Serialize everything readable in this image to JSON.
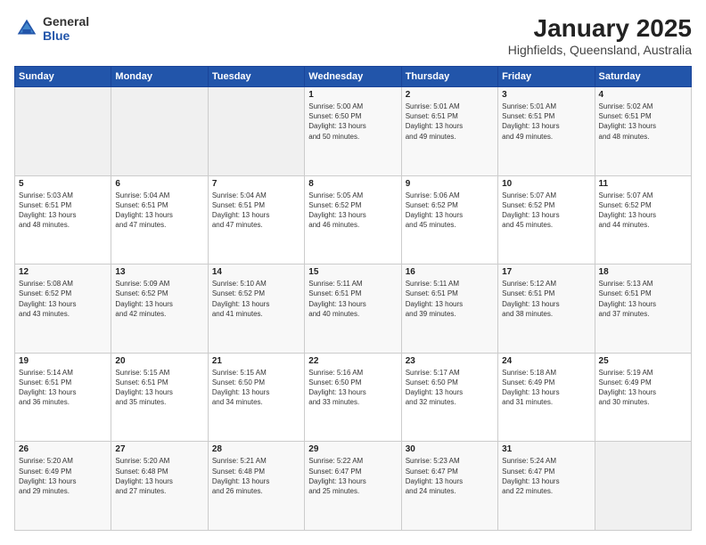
{
  "header": {
    "logo": {
      "line1": "General",
      "line2": "Blue"
    },
    "title": "January 2025",
    "subtitle": "Highfields, Queensland, Australia"
  },
  "weekdays": [
    "Sunday",
    "Monday",
    "Tuesday",
    "Wednesday",
    "Thursday",
    "Friday",
    "Saturday"
  ],
  "weeks": [
    [
      {
        "day": "",
        "info": ""
      },
      {
        "day": "",
        "info": ""
      },
      {
        "day": "",
        "info": ""
      },
      {
        "day": "1",
        "info": "Sunrise: 5:00 AM\nSunset: 6:50 PM\nDaylight: 13 hours\nand 50 minutes."
      },
      {
        "day": "2",
        "info": "Sunrise: 5:01 AM\nSunset: 6:51 PM\nDaylight: 13 hours\nand 49 minutes."
      },
      {
        "day": "3",
        "info": "Sunrise: 5:01 AM\nSunset: 6:51 PM\nDaylight: 13 hours\nand 49 minutes."
      },
      {
        "day": "4",
        "info": "Sunrise: 5:02 AM\nSunset: 6:51 PM\nDaylight: 13 hours\nand 48 minutes."
      }
    ],
    [
      {
        "day": "5",
        "info": "Sunrise: 5:03 AM\nSunset: 6:51 PM\nDaylight: 13 hours\nand 48 minutes."
      },
      {
        "day": "6",
        "info": "Sunrise: 5:04 AM\nSunset: 6:51 PM\nDaylight: 13 hours\nand 47 minutes."
      },
      {
        "day": "7",
        "info": "Sunrise: 5:04 AM\nSunset: 6:51 PM\nDaylight: 13 hours\nand 47 minutes."
      },
      {
        "day": "8",
        "info": "Sunrise: 5:05 AM\nSunset: 6:52 PM\nDaylight: 13 hours\nand 46 minutes."
      },
      {
        "day": "9",
        "info": "Sunrise: 5:06 AM\nSunset: 6:52 PM\nDaylight: 13 hours\nand 45 minutes."
      },
      {
        "day": "10",
        "info": "Sunrise: 5:07 AM\nSunset: 6:52 PM\nDaylight: 13 hours\nand 45 minutes."
      },
      {
        "day": "11",
        "info": "Sunrise: 5:07 AM\nSunset: 6:52 PM\nDaylight: 13 hours\nand 44 minutes."
      }
    ],
    [
      {
        "day": "12",
        "info": "Sunrise: 5:08 AM\nSunset: 6:52 PM\nDaylight: 13 hours\nand 43 minutes."
      },
      {
        "day": "13",
        "info": "Sunrise: 5:09 AM\nSunset: 6:52 PM\nDaylight: 13 hours\nand 42 minutes."
      },
      {
        "day": "14",
        "info": "Sunrise: 5:10 AM\nSunset: 6:52 PM\nDaylight: 13 hours\nand 41 minutes."
      },
      {
        "day": "15",
        "info": "Sunrise: 5:11 AM\nSunset: 6:51 PM\nDaylight: 13 hours\nand 40 minutes."
      },
      {
        "day": "16",
        "info": "Sunrise: 5:11 AM\nSunset: 6:51 PM\nDaylight: 13 hours\nand 39 minutes."
      },
      {
        "day": "17",
        "info": "Sunrise: 5:12 AM\nSunset: 6:51 PM\nDaylight: 13 hours\nand 38 minutes."
      },
      {
        "day": "18",
        "info": "Sunrise: 5:13 AM\nSunset: 6:51 PM\nDaylight: 13 hours\nand 37 minutes."
      }
    ],
    [
      {
        "day": "19",
        "info": "Sunrise: 5:14 AM\nSunset: 6:51 PM\nDaylight: 13 hours\nand 36 minutes."
      },
      {
        "day": "20",
        "info": "Sunrise: 5:15 AM\nSunset: 6:51 PM\nDaylight: 13 hours\nand 35 minutes."
      },
      {
        "day": "21",
        "info": "Sunrise: 5:15 AM\nSunset: 6:50 PM\nDaylight: 13 hours\nand 34 minutes."
      },
      {
        "day": "22",
        "info": "Sunrise: 5:16 AM\nSunset: 6:50 PM\nDaylight: 13 hours\nand 33 minutes."
      },
      {
        "day": "23",
        "info": "Sunrise: 5:17 AM\nSunset: 6:50 PM\nDaylight: 13 hours\nand 32 minutes."
      },
      {
        "day": "24",
        "info": "Sunrise: 5:18 AM\nSunset: 6:49 PM\nDaylight: 13 hours\nand 31 minutes."
      },
      {
        "day": "25",
        "info": "Sunrise: 5:19 AM\nSunset: 6:49 PM\nDaylight: 13 hours\nand 30 minutes."
      }
    ],
    [
      {
        "day": "26",
        "info": "Sunrise: 5:20 AM\nSunset: 6:49 PM\nDaylight: 13 hours\nand 29 minutes."
      },
      {
        "day": "27",
        "info": "Sunrise: 5:20 AM\nSunset: 6:48 PM\nDaylight: 13 hours\nand 27 minutes."
      },
      {
        "day": "28",
        "info": "Sunrise: 5:21 AM\nSunset: 6:48 PM\nDaylight: 13 hours\nand 26 minutes."
      },
      {
        "day": "29",
        "info": "Sunrise: 5:22 AM\nSunset: 6:47 PM\nDaylight: 13 hours\nand 25 minutes."
      },
      {
        "day": "30",
        "info": "Sunrise: 5:23 AM\nSunset: 6:47 PM\nDaylight: 13 hours\nand 24 minutes."
      },
      {
        "day": "31",
        "info": "Sunrise: 5:24 AM\nSunset: 6:47 PM\nDaylight: 13 hours\nand 22 minutes."
      },
      {
        "day": "",
        "info": ""
      }
    ]
  ]
}
